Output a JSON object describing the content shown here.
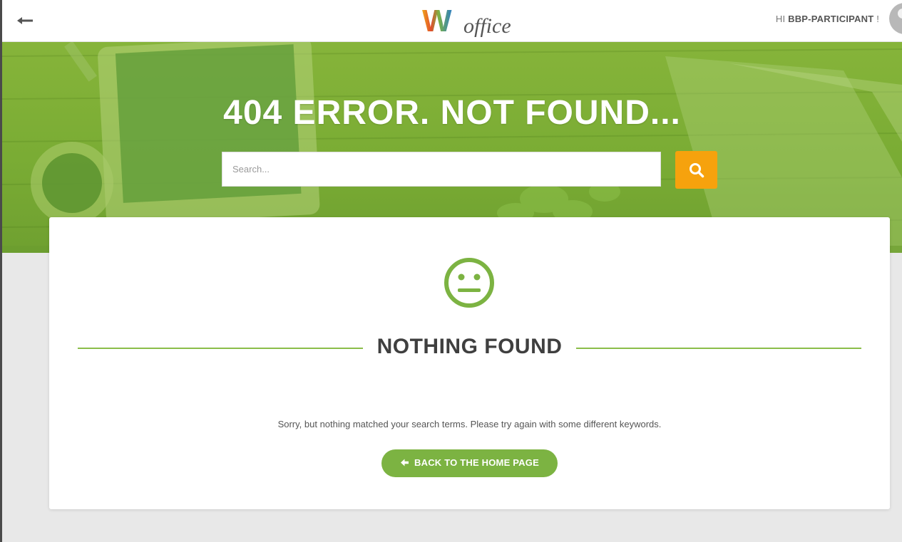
{
  "header": {
    "logo_letter": "W",
    "logo_word": "office",
    "greeting_prefix": "HI",
    "username": "BBP-PARTICIPANT",
    "greeting_suffix": "!",
    "back_icon": "arrow-left-icon",
    "avatar_icon": "user-avatar-icon"
  },
  "hero": {
    "title": "404 ERROR. NOT FOUND...",
    "search_placeholder": "Search...",
    "search_icon": "search-icon"
  },
  "content": {
    "face_icon": "neutral-face-icon",
    "heading": "NOTHING FOUND",
    "message": "Sorry, but nothing matched your search terms. Please try again with some different keywords.",
    "home_button_label": "BACK TO THE HOME PAGE",
    "home_button_icon": "arrow-left-circle-icon"
  },
  "colors": {
    "accent_green": "#7cb342",
    "search_orange": "#f6a20d",
    "heading_text": "#3f3f3f"
  }
}
